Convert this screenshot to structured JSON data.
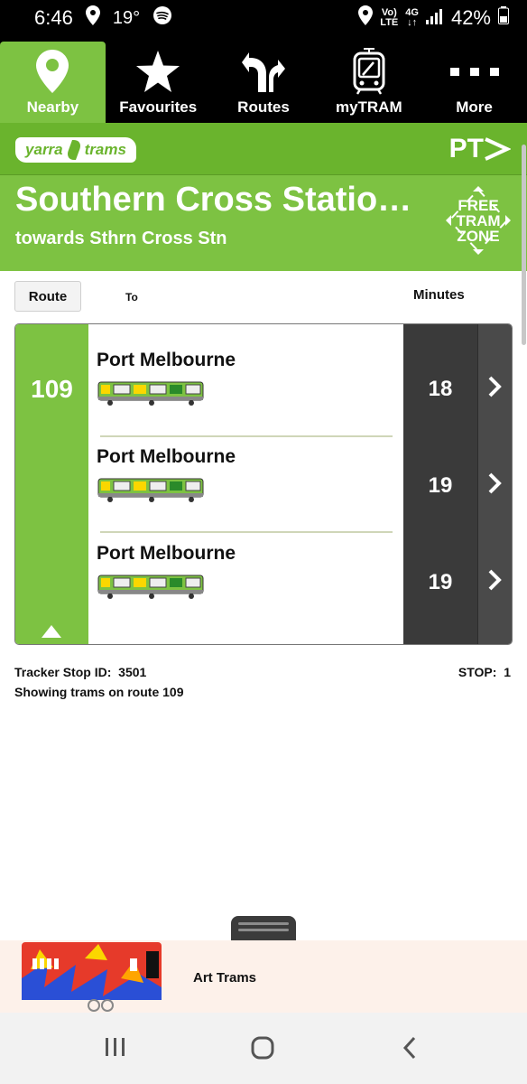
{
  "status_bar": {
    "time": "6:46",
    "temperature": "19°",
    "net_top": "Vo)",
    "net_bottom": "LTE",
    "data_top": "4G",
    "data_bottom": "↓↑",
    "battery": "42%",
    "icons": [
      "location-icon",
      "spotify-icon",
      "signal-icon",
      "battery-icon"
    ]
  },
  "tabs": [
    {
      "label": "Nearby",
      "icon": "location-pin-icon",
      "active": true
    },
    {
      "label": "Favourites",
      "icon": "star-icon",
      "active": false
    },
    {
      "label": "Routes",
      "icon": "split-arrows-icon",
      "active": false
    },
    {
      "label": "myTRAM",
      "icon": "tram-phone-icon",
      "active": false
    },
    {
      "label": "More",
      "icon": "more-dots-icon",
      "active": false
    }
  ],
  "brand": {
    "logo_left": "yarra",
    "logo_right": "trams",
    "pt_logo": "PT"
  },
  "stop": {
    "title": "Southern Cross Statio…",
    "subtitle": "towards Sthrn Cross Stn",
    "free_zone_lines": [
      "FREE",
      "TRAM",
      "ZONE"
    ]
  },
  "columns": {
    "route_button": "Route",
    "to": "To",
    "minutes": "Minutes"
  },
  "departures": {
    "route": "109",
    "rows": [
      {
        "destination": "Port Melbourne",
        "minutes": "18"
      },
      {
        "destination": "Port Melbourne",
        "minutes": "19"
      },
      {
        "destination": "Port Melbourne",
        "minutes": "19"
      }
    ]
  },
  "info": {
    "tracker_label": "Tracker Stop ID:",
    "tracker_id": "3501",
    "showing": "Showing trams on route 109",
    "stop_label": "STOP:",
    "stop_number": "1"
  },
  "banner": {
    "label": "Art Trams"
  },
  "colors": {
    "brand_green": "#7dc242",
    "dark_green": "#6ab42d",
    "minutes_bg": "#3a3a3a"
  }
}
